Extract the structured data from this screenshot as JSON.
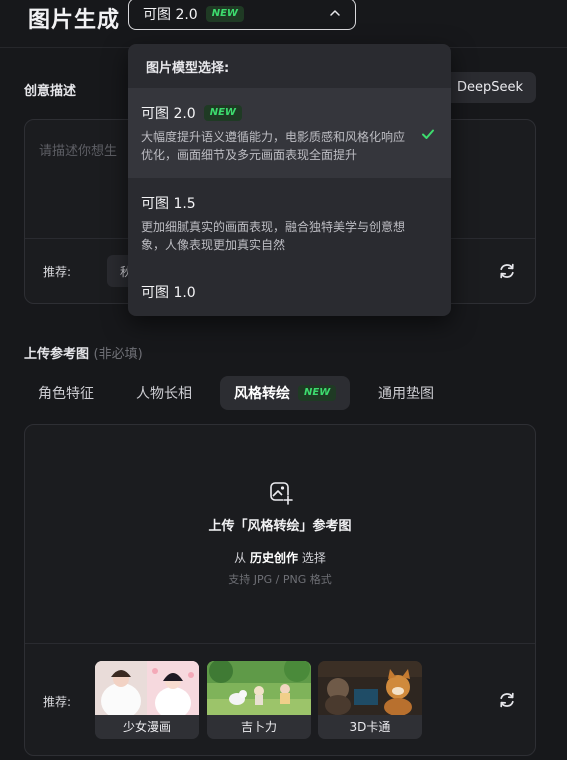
{
  "header": {
    "title": "图片生成",
    "model_selector": {
      "value": "可图 2.0",
      "badge": "NEW"
    }
  },
  "dropdown": {
    "heading": "图片模型选择:",
    "options": [
      {
        "name": "可图 2.0",
        "badge": "NEW",
        "description": "大幅度提升语义遵循能力，电影质感和风格化响应优化，画面细节及多元画面表现全面提升",
        "selected": true
      },
      {
        "name": "可图 1.5",
        "description": "更加细腻真实的画面表现，融合独特美学与创意想象，人像表现更加真实自然",
        "selected": false
      },
      {
        "name": "可图 1.0",
        "selected": false
      }
    ]
  },
  "prompt": {
    "label": "创意描述",
    "deepseek_label": "DeepSeek",
    "placeholder": "请描述你想生",
    "recommend_label": "推荐:",
    "recommend_chip": "秋"
  },
  "upload": {
    "label": "上传参考图",
    "optional": "(非必填)",
    "tabs": [
      {
        "label": "角色特征",
        "active": false
      },
      {
        "label": "人物长相",
        "active": false
      },
      {
        "label": "风格转绘",
        "active": true,
        "badge": "NEW"
      },
      {
        "label": "通用垫图",
        "active": false
      }
    ],
    "title": "上传「风格转绘」参考图",
    "history_prefix": "从",
    "history_link": "历史创作",
    "history_suffix": "选择",
    "formats": "支持 JPG / PNG 格式",
    "recommend_label": "推荐:",
    "styles": [
      {
        "label": "少女漫画"
      },
      {
        "label": "吉卜力"
      },
      {
        "label": "3D卡通"
      }
    ]
  },
  "icons": {
    "chevron": "chevron-up-icon",
    "check": "check-icon",
    "refresh": "refresh-icon",
    "upload": "image-add-icon"
  },
  "colors": {
    "background": "#17181b",
    "new_badge_text": "#3ddc6e",
    "new_badge_bg": "#1f3a24",
    "check": "#3ddc6e"
  }
}
